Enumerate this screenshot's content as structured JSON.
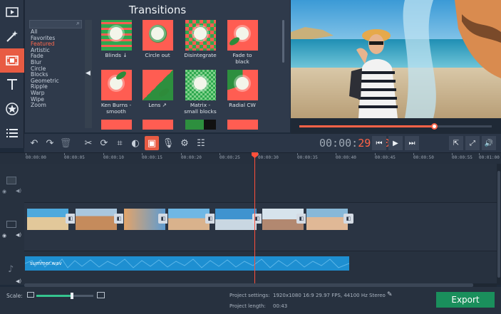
{
  "colors": {
    "accent": "#e85b43",
    "playhead": "#ff4f3a",
    "export": "#1a8f5c",
    "audio": "#1e8fd1"
  },
  "rail": {
    "items": [
      {
        "icon": "film-play-icon"
      },
      {
        "icon": "magic-wand-icon"
      },
      {
        "icon": "transitions-film-icon",
        "active": true
      },
      {
        "icon": "text-tool-icon"
      },
      {
        "icon": "star-sticker-icon"
      },
      {
        "icon": "list-menu-icon"
      }
    ]
  },
  "transitions": {
    "title": "Transitions",
    "categories": [
      "All",
      "Favorites",
      "Featured",
      "Artistic",
      "Fade",
      "Blur",
      "Circle",
      "Blocks",
      "Geometric",
      "Ripple",
      "Warp",
      "Wipe",
      "Zoom"
    ],
    "selected_category": "Featured",
    "tiles": [
      {
        "label": "Blinds ↓"
      },
      {
        "label": "Circle out"
      },
      {
        "label": "Disintegrate"
      },
      {
        "label": "Fade to\nblack"
      },
      {
        "label": "Ken Burns -\nsmooth"
      },
      {
        "label": "Lens ↗"
      },
      {
        "label": "Matrix -\nsmall blocks"
      },
      {
        "label": "Radial CW"
      }
    ]
  },
  "preview": {
    "progress_fraction": 0.7
  },
  "toolbar": {
    "timecode_main": "00:00:",
    "timecode_hot": "29.700"
  },
  "ruler": {
    "ticks": [
      "00:00:00",
      "00:00:05",
      "00:00:10",
      "00:00:15",
      "00:00:20",
      "00:00:25",
      "00:00:30",
      "00:00:35",
      "00:00:40",
      "00:00:45",
      "00:00:50",
      "00:00:55",
      "00:01:00"
    ]
  },
  "audio": {
    "label": "summer.wav"
  },
  "status": {
    "scale_label": "Scale:",
    "scale_fraction": 0.62,
    "settings_key": "Project settings:",
    "settings_value": "1920x1080 16:9 29.97 FPS, 44100 Hz Stereo",
    "length_key": "Project length:",
    "length_value": "00:43",
    "export_label": "Export"
  }
}
